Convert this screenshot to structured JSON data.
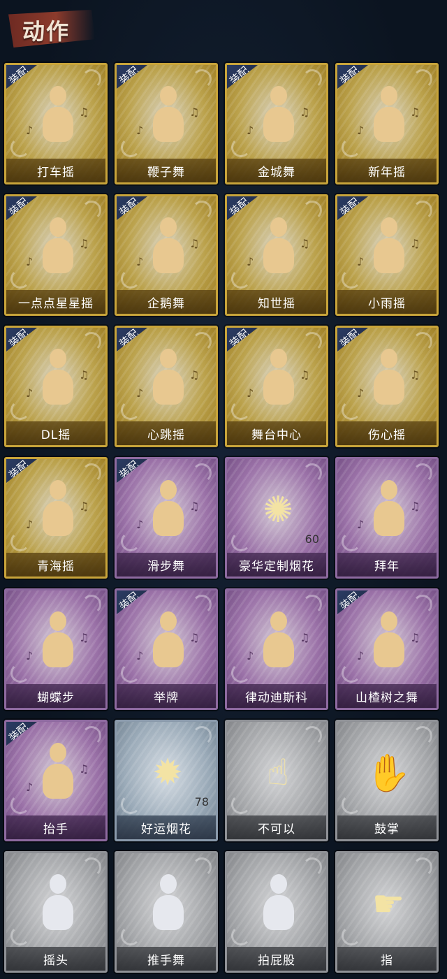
{
  "header": {
    "title": "动作"
  },
  "cards": [
    {
      "name": "打车摇",
      "tier": "gold",
      "equipped": true,
      "icon": "dance-figure-icon"
    },
    {
      "name": "鞭子舞",
      "tier": "gold",
      "equipped": true,
      "icon": "dance-figure-icon"
    },
    {
      "name": "金城舞",
      "tier": "gold",
      "equipped": true,
      "icon": "dance-figure-icon"
    },
    {
      "name": "新年摇",
      "tier": "gold",
      "equipped": true,
      "icon": "dance-figure-icon"
    },
    {
      "name": "一点点星星摇",
      "tier": "gold",
      "equipped": true,
      "icon": "dance-figure-icon"
    },
    {
      "name": "企鹅舞",
      "tier": "gold",
      "equipped": true,
      "icon": "dance-figure-icon"
    },
    {
      "name": "知世摇",
      "tier": "gold",
      "equipped": true,
      "icon": "dance-figure-icon"
    },
    {
      "name": "小雨摇",
      "tier": "gold",
      "equipped": true,
      "icon": "dance-figure-icon"
    },
    {
      "name": "DL摇",
      "tier": "gold",
      "equipped": true,
      "icon": "dance-figure-icon"
    },
    {
      "name": "心跳摇",
      "tier": "gold",
      "equipped": true,
      "icon": "dance-figure-icon"
    },
    {
      "name": "舞台中心",
      "tier": "gold",
      "equipped": true,
      "icon": "dance-figure-icon"
    },
    {
      "name": "伤心摇",
      "tier": "gold",
      "equipped": true,
      "icon": "heart-hands-figure-icon"
    },
    {
      "name": "青海摇",
      "tier": "gold",
      "equipped": true,
      "icon": "dance-figure-icon"
    },
    {
      "name": "滑步舞",
      "tier": "purple",
      "equipped": true,
      "icon": "dance-figure-icon"
    },
    {
      "name": "豪华定制烟花",
      "tier": "purple",
      "equipped": false,
      "icon": "fireworks-box-icon",
      "count": "60"
    },
    {
      "name": "拜年",
      "tier": "purple",
      "equipped": false,
      "icon": "greeting-figure-icon"
    },
    {
      "name": "蝴蝶步",
      "tier": "purple",
      "equipped": false,
      "icon": "dance-figure-icon"
    },
    {
      "name": "举牌",
      "tier": "purple",
      "equipped": true,
      "icon": "sign-figure-icon"
    },
    {
      "name": "律动迪斯科",
      "tier": "purple",
      "equipped": false,
      "icon": "dance-figure-icon"
    },
    {
      "name": "山楂树之舞",
      "tier": "purple",
      "equipped": true,
      "icon": "dance-figure-icon"
    },
    {
      "name": "抬手",
      "tier": "purple",
      "equipped": true,
      "icon": "raise-hand-figure-icon"
    },
    {
      "name": "好运烟花",
      "tier": "blue",
      "equipped": false,
      "icon": "firework-tube-icon",
      "count": "78"
    },
    {
      "name": "不可以",
      "tier": "grey",
      "equipped": false,
      "icon": "finger-wag-icon"
    },
    {
      "name": "鼓掌",
      "tier": "grey",
      "equipped": false,
      "icon": "clapping-hands-icon"
    },
    {
      "name": "摇头",
      "tier": "grey",
      "equipped": false,
      "icon": "shake-head-figure-icon"
    },
    {
      "name": "推手舞",
      "tier": "grey",
      "equipped": false,
      "icon": "push-hands-figure-icon"
    },
    {
      "name": "拍屁股",
      "tier": "grey",
      "equipped": false,
      "icon": "spank-figure-icon"
    },
    {
      "name": "指",
      "tier": "grey",
      "equipped": false,
      "icon": "pointing-hand-icon"
    }
  ],
  "equip_label": "装配"
}
